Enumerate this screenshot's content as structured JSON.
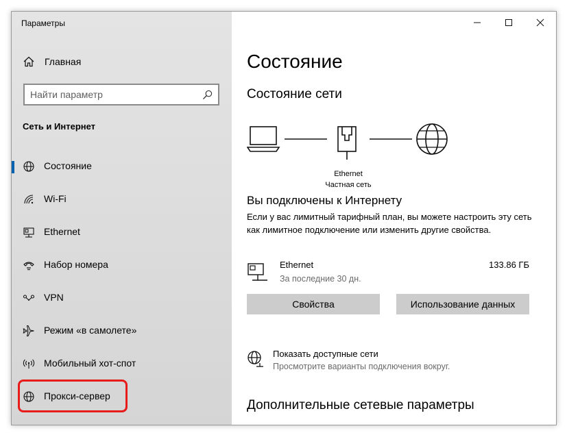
{
  "window": {
    "title": "Параметры"
  },
  "sidebar": {
    "home_label": "Главная",
    "search_placeholder": "Найти параметр",
    "section_title": "Сеть и Интернет",
    "items": [
      {
        "label": "Состояние",
        "icon": "globe-icon",
        "active": true
      },
      {
        "label": "Wi-Fi",
        "icon": "wifi-icon"
      },
      {
        "label": "Ethernet",
        "icon": "ethernet-icon"
      },
      {
        "label": "Набор номера",
        "icon": "dialup-icon"
      },
      {
        "label": "VPN",
        "icon": "vpn-icon"
      },
      {
        "label": "Режим «в самолете»",
        "icon": "airplane-icon"
      },
      {
        "label": "Мобильный хот-спот",
        "icon": "hotspot-icon"
      },
      {
        "label": "Прокси-сервер",
        "icon": "globe-icon",
        "highlighted": true
      }
    ],
    "highlight_color": "#e81b1b",
    "accent_color": "#0063b1"
  },
  "main": {
    "title": "Состояние",
    "network_status_title": "Состояние сети",
    "diagram": {
      "adapter_name": "Ethernet",
      "network_type": "Частная сеть"
    },
    "connected_title": "Вы подключены к Интернету",
    "connected_desc": "Если у вас лимитный тарифный план, вы можете настроить эту сеть как лимитное подключение или изменить другие свойства.",
    "connection": {
      "name": "Ethernet",
      "period": "За последние 30 дн.",
      "usage": "133.86 ГБ"
    },
    "buttons": {
      "properties": "Свойства",
      "data_usage": "Использование данных"
    },
    "show_networks": {
      "title": "Показать доступные сети",
      "subtitle": "Просмотрите варианты подключения вокруг."
    },
    "advanced_title": "Дополнительные сетевые параметры"
  }
}
